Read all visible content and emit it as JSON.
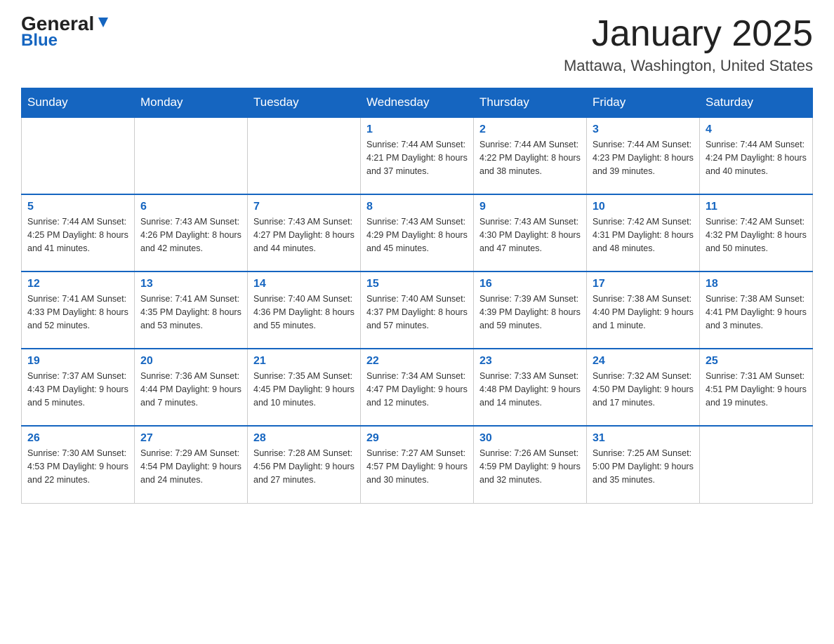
{
  "logo": {
    "general": "General",
    "blue": "Blue"
  },
  "header": {
    "month_year": "January 2025",
    "location": "Mattawa, Washington, United States"
  },
  "days_of_week": [
    "Sunday",
    "Monday",
    "Tuesday",
    "Wednesday",
    "Thursday",
    "Friday",
    "Saturday"
  ],
  "weeks": [
    [
      {
        "day": "",
        "info": ""
      },
      {
        "day": "",
        "info": ""
      },
      {
        "day": "",
        "info": ""
      },
      {
        "day": "1",
        "info": "Sunrise: 7:44 AM\nSunset: 4:21 PM\nDaylight: 8 hours\nand 37 minutes."
      },
      {
        "day": "2",
        "info": "Sunrise: 7:44 AM\nSunset: 4:22 PM\nDaylight: 8 hours\nand 38 minutes."
      },
      {
        "day": "3",
        "info": "Sunrise: 7:44 AM\nSunset: 4:23 PM\nDaylight: 8 hours\nand 39 minutes."
      },
      {
        "day": "4",
        "info": "Sunrise: 7:44 AM\nSunset: 4:24 PM\nDaylight: 8 hours\nand 40 minutes."
      }
    ],
    [
      {
        "day": "5",
        "info": "Sunrise: 7:44 AM\nSunset: 4:25 PM\nDaylight: 8 hours\nand 41 minutes."
      },
      {
        "day": "6",
        "info": "Sunrise: 7:43 AM\nSunset: 4:26 PM\nDaylight: 8 hours\nand 42 minutes."
      },
      {
        "day": "7",
        "info": "Sunrise: 7:43 AM\nSunset: 4:27 PM\nDaylight: 8 hours\nand 44 minutes."
      },
      {
        "day": "8",
        "info": "Sunrise: 7:43 AM\nSunset: 4:29 PM\nDaylight: 8 hours\nand 45 minutes."
      },
      {
        "day": "9",
        "info": "Sunrise: 7:43 AM\nSunset: 4:30 PM\nDaylight: 8 hours\nand 47 minutes."
      },
      {
        "day": "10",
        "info": "Sunrise: 7:42 AM\nSunset: 4:31 PM\nDaylight: 8 hours\nand 48 minutes."
      },
      {
        "day": "11",
        "info": "Sunrise: 7:42 AM\nSunset: 4:32 PM\nDaylight: 8 hours\nand 50 minutes."
      }
    ],
    [
      {
        "day": "12",
        "info": "Sunrise: 7:41 AM\nSunset: 4:33 PM\nDaylight: 8 hours\nand 52 minutes."
      },
      {
        "day": "13",
        "info": "Sunrise: 7:41 AM\nSunset: 4:35 PM\nDaylight: 8 hours\nand 53 minutes."
      },
      {
        "day": "14",
        "info": "Sunrise: 7:40 AM\nSunset: 4:36 PM\nDaylight: 8 hours\nand 55 minutes."
      },
      {
        "day": "15",
        "info": "Sunrise: 7:40 AM\nSunset: 4:37 PM\nDaylight: 8 hours\nand 57 minutes."
      },
      {
        "day": "16",
        "info": "Sunrise: 7:39 AM\nSunset: 4:39 PM\nDaylight: 8 hours\nand 59 minutes."
      },
      {
        "day": "17",
        "info": "Sunrise: 7:38 AM\nSunset: 4:40 PM\nDaylight: 9 hours\nand 1 minute."
      },
      {
        "day": "18",
        "info": "Sunrise: 7:38 AM\nSunset: 4:41 PM\nDaylight: 9 hours\nand 3 minutes."
      }
    ],
    [
      {
        "day": "19",
        "info": "Sunrise: 7:37 AM\nSunset: 4:43 PM\nDaylight: 9 hours\nand 5 minutes."
      },
      {
        "day": "20",
        "info": "Sunrise: 7:36 AM\nSunset: 4:44 PM\nDaylight: 9 hours\nand 7 minutes."
      },
      {
        "day": "21",
        "info": "Sunrise: 7:35 AM\nSunset: 4:45 PM\nDaylight: 9 hours\nand 10 minutes."
      },
      {
        "day": "22",
        "info": "Sunrise: 7:34 AM\nSunset: 4:47 PM\nDaylight: 9 hours\nand 12 minutes."
      },
      {
        "day": "23",
        "info": "Sunrise: 7:33 AM\nSunset: 4:48 PM\nDaylight: 9 hours\nand 14 minutes."
      },
      {
        "day": "24",
        "info": "Sunrise: 7:32 AM\nSunset: 4:50 PM\nDaylight: 9 hours\nand 17 minutes."
      },
      {
        "day": "25",
        "info": "Sunrise: 7:31 AM\nSunset: 4:51 PM\nDaylight: 9 hours\nand 19 minutes."
      }
    ],
    [
      {
        "day": "26",
        "info": "Sunrise: 7:30 AM\nSunset: 4:53 PM\nDaylight: 9 hours\nand 22 minutes."
      },
      {
        "day": "27",
        "info": "Sunrise: 7:29 AM\nSunset: 4:54 PM\nDaylight: 9 hours\nand 24 minutes."
      },
      {
        "day": "28",
        "info": "Sunrise: 7:28 AM\nSunset: 4:56 PM\nDaylight: 9 hours\nand 27 minutes."
      },
      {
        "day": "29",
        "info": "Sunrise: 7:27 AM\nSunset: 4:57 PM\nDaylight: 9 hours\nand 30 minutes."
      },
      {
        "day": "30",
        "info": "Sunrise: 7:26 AM\nSunset: 4:59 PM\nDaylight: 9 hours\nand 32 minutes."
      },
      {
        "day": "31",
        "info": "Sunrise: 7:25 AM\nSunset: 5:00 PM\nDaylight: 9 hours\nand 35 minutes."
      },
      {
        "day": "",
        "info": ""
      }
    ]
  ]
}
